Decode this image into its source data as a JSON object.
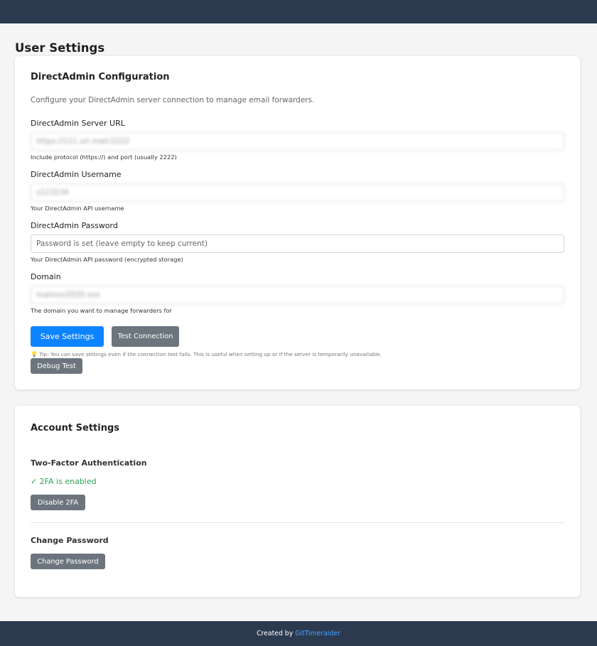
{
  "header": {},
  "page": {
    "title": "User Settings"
  },
  "directadmin": {
    "title": "DirectAdmin Configuration",
    "description": "Configure your DirectAdmin server connection to manage email forwarders.",
    "server_url": {
      "label": "DirectAdmin Server URL",
      "value": "https://111.url.mail:2222",
      "help": "Include protocol (https://) and port (usually 2222)"
    },
    "username": {
      "label": "DirectAdmin Username",
      "value": "s123234",
      "help": "Your DirectAdmin API username"
    },
    "password": {
      "label": "DirectAdmin Password",
      "placeholder": "Password is set (leave empty to keep current)",
      "help": "Your DirectAdmin API password (encrypted storage)"
    },
    "domain": {
      "label": "Domain",
      "value": "mailxxx2020.xxx",
      "help": "The domain you want to manage forwarders for"
    },
    "save_button": "Save Settings",
    "test_button": "Test Connection",
    "tip": "Tip: You can save settings even if the connection test fails. This is useful when setting up or if the server is temporarily unavailable.",
    "debug_button": "Debug Test"
  },
  "account": {
    "title": "Account Settings",
    "twofa": {
      "label": "Two-Factor Authentication",
      "status": "✓ 2FA is enabled",
      "disable_button": "Disable 2FA"
    },
    "change_password": {
      "label": "Change Password",
      "button": "Change Password"
    }
  },
  "footer": {
    "prefix": "Created by",
    "author": "GitTimeraider"
  },
  "colors": {
    "header_bg": "#2c3a4f",
    "primary": "#0d84ff",
    "secondary": "#6c757d",
    "success": "#2ea44f",
    "link": "#4aa3ff"
  }
}
